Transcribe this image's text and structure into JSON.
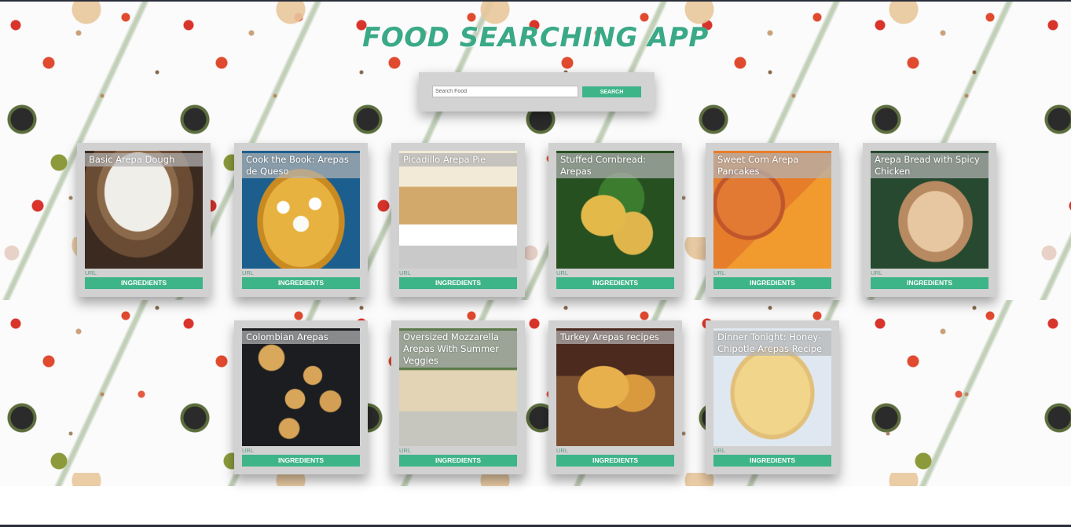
{
  "header": {
    "title": "FOOD SEARCHING APP"
  },
  "search": {
    "placeholder": "Search Food",
    "value": "",
    "button_label": "SEARCH"
  },
  "recipes": [
    {
      "title": "Basic Arepa Dough",
      "url_label": "URL",
      "button_label": "INGREDIENTS"
    },
    {
      "title": "Cook the Book: Arepas de Queso",
      "url_label": "URL",
      "button_label": "INGREDIENTS"
    },
    {
      "title": "Picadillo Arepa Pie",
      "url_label": "URL",
      "button_label": "INGREDIENTS"
    },
    {
      "title": "Stuffed Cornbread: Arepas",
      "url_label": "URL",
      "button_label": "INGREDIENTS"
    },
    {
      "title": "Sweet Corn Arepa Pancakes",
      "url_label": "URL",
      "button_label": "INGREDIENTS"
    },
    {
      "title": "Arepa Bread with Spicy Chicken",
      "url_label": "URL",
      "button_label": "INGREDIENTS"
    },
    {
      "title": "Colombian Arepas",
      "url_label": "URL",
      "button_label": "INGREDIENTS"
    },
    {
      "title": "Oversized Mozzarella Arepas With Summer Veggies",
      "url_label": "URL",
      "button_label": "INGREDIENTS"
    },
    {
      "title": "Turkey Arepas recipes",
      "url_label": "URL",
      "button_label": "INGREDIENTS"
    },
    {
      "title": "Dinner Tonight: Honey-Chipotle Arepas Recipe",
      "url_label": "URL",
      "button_label": "INGREDIENTS"
    }
  ],
  "colors": {
    "accent": "#3eb489",
    "title": "#3aa987",
    "card": "#d1d1d1"
  }
}
